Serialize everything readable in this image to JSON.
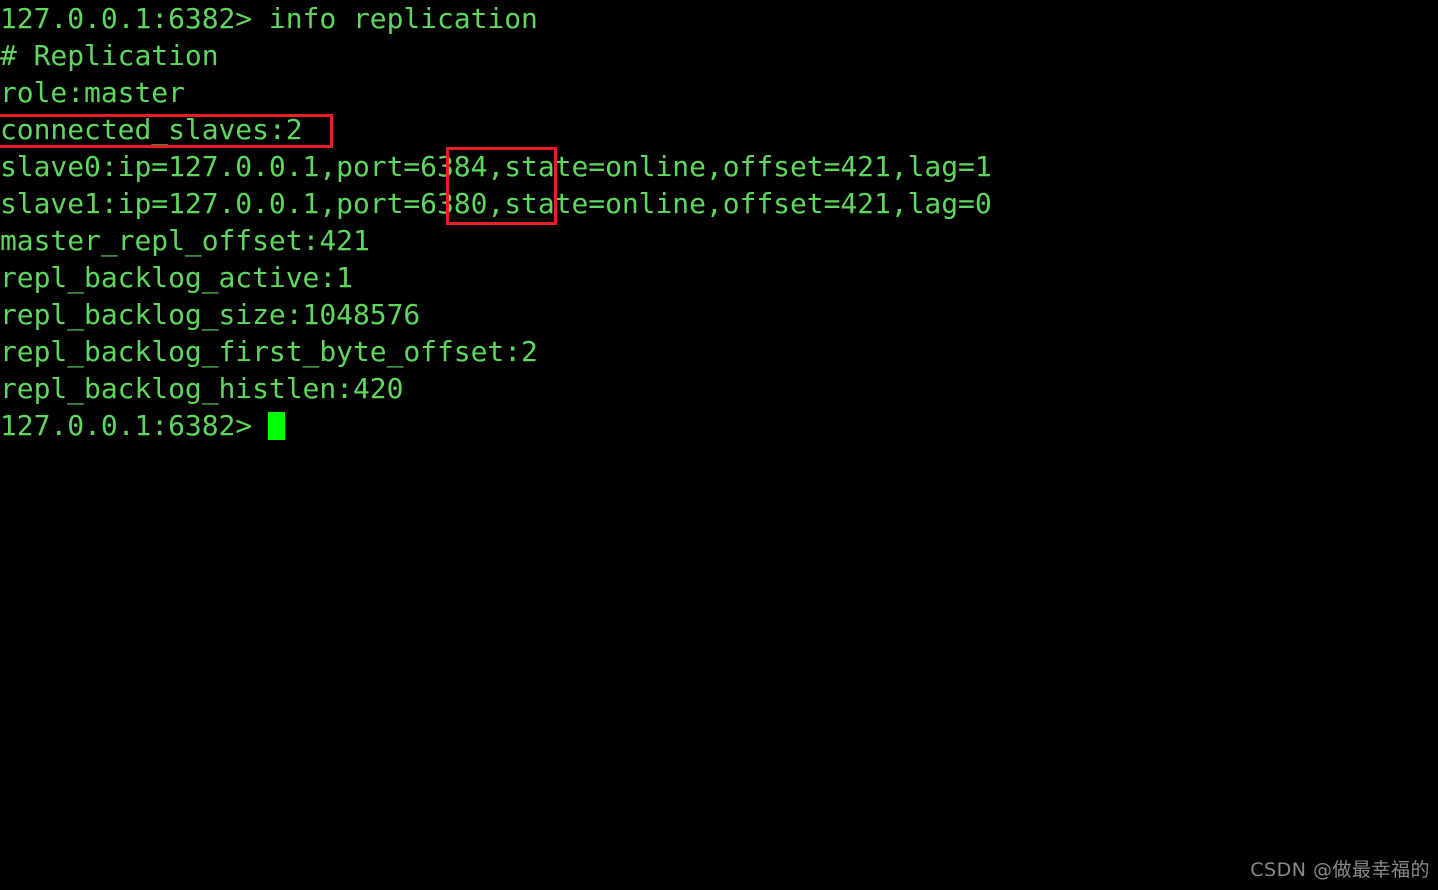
{
  "terminal": {
    "prompt": "127.0.0.1:6382>",
    "command": "info replication",
    "lines": [
      "127.0.0.1:6382> info replication",
      "# Replication",
      "role:master",
      "connected_slaves:2",
      "slave0:ip=127.0.0.1,port=6384,state=online,offset=421,lag=1",
      "slave1:ip=127.0.0.1,port=6380,state=online,offset=421,lag=0",
      "master_repl_offset:421",
      "repl_backlog_active:1",
      "repl_backlog_size:1048576",
      "repl_backlog_first_byte_offset:2",
      "repl_backlog_histlen:420",
      "127.0.0.1:6382>"
    ],
    "replication_info": {
      "section_header": "# Replication",
      "role": "master",
      "connected_slaves": "2",
      "slave0": {
        "ip": "127.0.0.1",
        "port": "6384",
        "state": "online",
        "offset": "421",
        "lag": "1"
      },
      "slave1": {
        "ip": "127.0.0.1",
        "port": "6380",
        "state": "online",
        "offset": "421",
        "lag": "0"
      },
      "master_repl_offset": "421",
      "repl_backlog_active": "1",
      "repl_backlog_size": "1048576",
      "repl_backlog_first_byte_offset": "2",
      "repl_backlog_histlen": "420"
    },
    "colors": {
      "background": "#000000",
      "text": "#5fd75f",
      "cursor": "#00ff00",
      "highlight": "#ee1c25",
      "watermark": "#8a8a8a"
    }
  },
  "watermark": {
    "text": "CSDN @做最幸福的"
  }
}
